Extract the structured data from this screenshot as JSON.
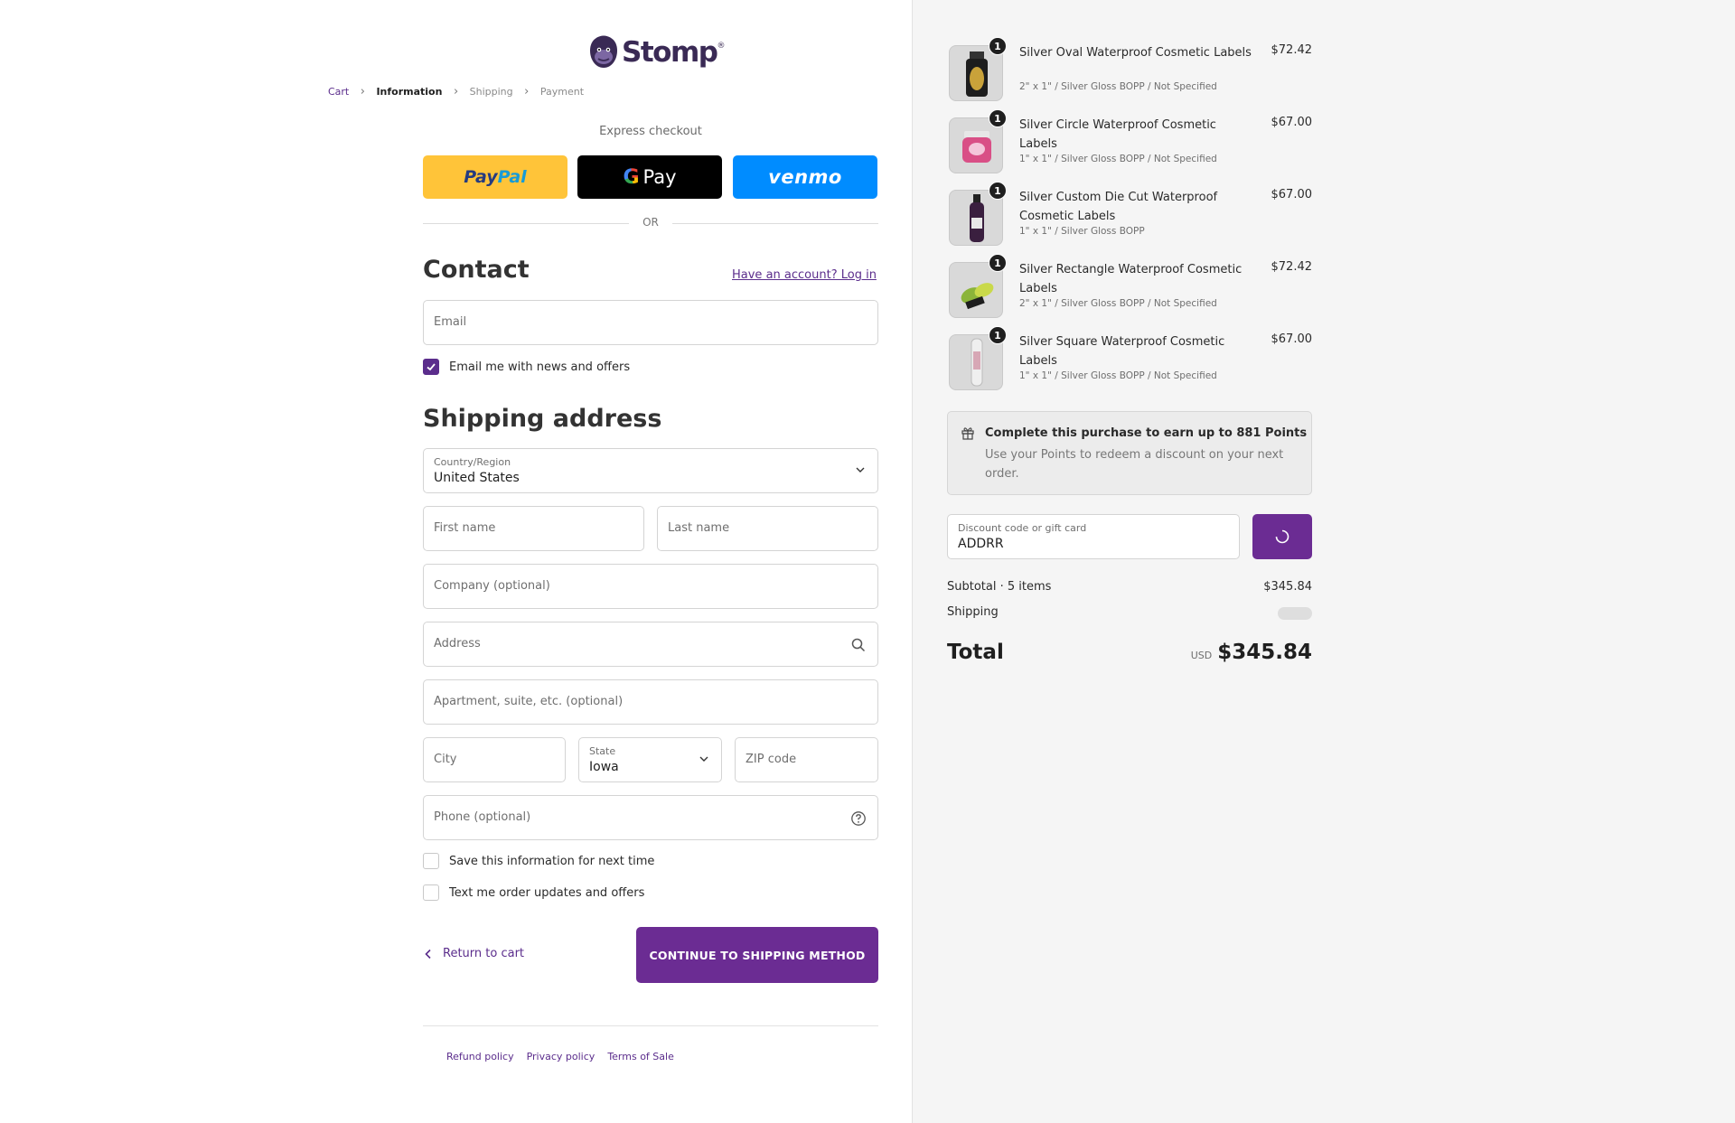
{
  "brand": {
    "name": "Stomp",
    "accent": "#6b2c93"
  },
  "breadcrumb": {
    "cart": "Cart",
    "information": "Information",
    "shipping": "Shipping",
    "payment": "Payment"
  },
  "express": {
    "title": "Express checkout",
    "paypal": {
      "p1": "Pay",
      "p2": "Pal"
    },
    "gpay": {
      "g": "G",
      "pay": "Pay"
    },
    "venmo": "venmo",
    "or": "OR"
  },
  "contact": {
    "heading": "Contact",
    "login_link": "Have an account? Log in",
    "email_placeholder": "Email",
    "newsletter_label": "Email me with news and offers",
    "newsletter_checked": true
  },
  "shipping": {
    "heading": "Shipping address",
    "country_label": "Country/Region",
    "country_value": "United States",
    "first_name_placeholder": "First name",
    "last_name_placeholder": "Last name",
    "company_placeholder": "Company (optional)",
    "address_placeholder": "Address",
    "apartment_placeholder": "Apartment, suite, etc. (optional)",
    "city_placeholder": "City",
    "state_label": "State",
    "state_value": "Iowa",
    "zip_placeholder": "ZIP code",
    "phone_placeholder": "Phone (optional)",
    "save_info_label": "Save this information for next time",
    "sms_label": "Text me order updates and offers"
  },
  "actions": {
    "return_label": "Return to cart",
    "continue_label": "CONTINUE TO SHIPPING METHOD"
  },
  "footer": {
    "refund": "Refund policy",
    "privacy": "Privacy policy",
    "terms": "Terms of Sale"
  },
  "order": {
    "items": [
      {
        "name": "Silver Oval Waterproof Cosmetic Labels",
        "variant": "2\" x 1\" / Silver Gloss BOPP / Not Specified",
        "price": "$72.42",
        "qty": "1"
      },
      {
        "name": "Silver Circle Waterproof Cosmetic Labels",
        "variant": "1\" x 1\" / Silver Gloss BOPP / Not Specified",
        "price": "$67.00",
        "qty": "1"
      },
      {
        "name": "Silver Custom Die Cut Waterproof Cosmetic Labels",
        "variant": "1\" x 1\" / Silver Gloss BOPP",
        "price": "$67.00",
        "qty": "1"
      },
      {
        "name": "Silver Rectangle Waterproof Cosmetic Labels",
        "variant": "2\" x 1\" / Silver Gloss BOPP / Not Specified",
        "price": "$72.42",
        "qty": "1"
      },
      {
        "name": "Silver Square Waterproof Cosmetic Labels",
        "variant": "1\" x 1\" / Silver Gloss BOPP / Not Specified",
        "price": "$67.00",
        "qty": "1"
      }
    ],
    "points": {
      "title": "Complete this purchase to earn up to 881 Points",
      "description": "Use your Points to redeem a discount on your next order."
    },
    "discount": {
      "label": "Discount code or gift card",
      "value": "ADDRR"
    },
    "subtotal_label": "Subtotal · 5 items",
    "subtotal_value": "$345.84",
    "shipping_label": "Shipping",
    "total_label": "Total",
    "total_currency": "USD",
    "total_value": "$345.84"
  }
}
